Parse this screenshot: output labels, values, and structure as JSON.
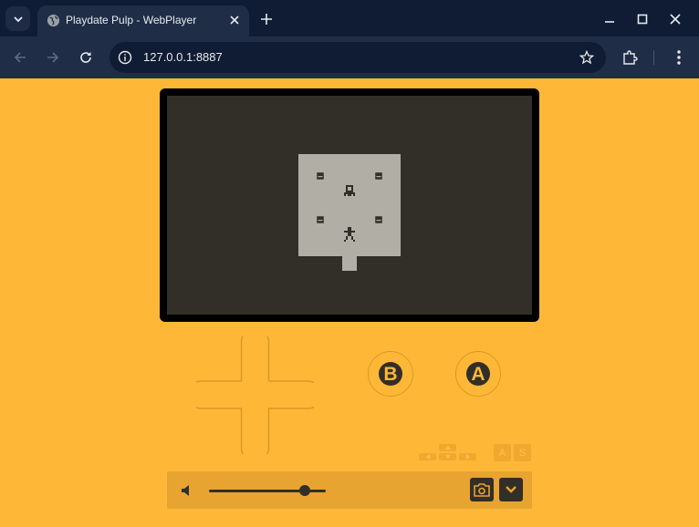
{
  "browser": {
    "tab": {
      "title": "Playdate Pulp - WebPlayer",
      "favicon": "globe-icon"
    },
    "address": {
      "url": "127.0.0.1:8887"
    }
  },
  "player": {
    "buttons": {
      "b_label": "B",
      "a_label": "A"
    },
    "keys": {
      "a": "A",
      "s": "S"
    },
    "volume": {
      "level": 0.82
    }
  },
  "colors": {
    "accent": "#ffb738",
    "screen_dark": "#322f28",
    "screen_light": "#b1aea6",
    "chrome_dark": "#0f1c33",
    "chrome_mid": "#1f2d47"
  }
}
